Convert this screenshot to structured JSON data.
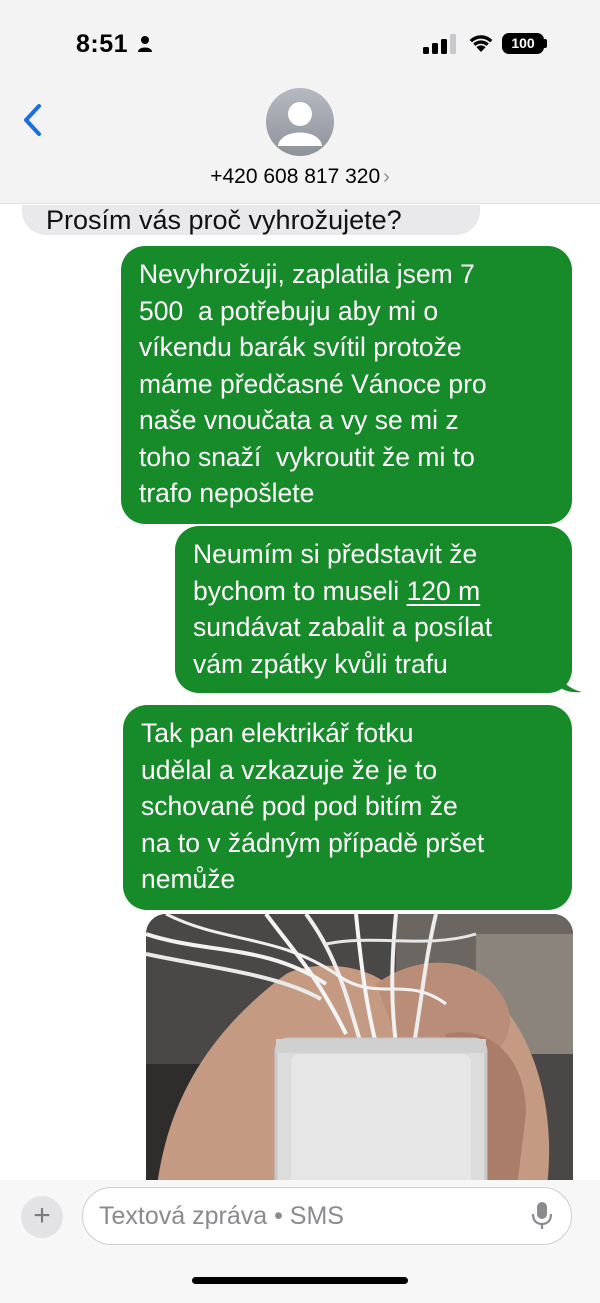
{
  "status_bar": {
    "time": "8:51",
    "battery": "100",
    "icons": [
      "person-icon",
      "cellular-signal-icon",
      "wifi-icon",
      "battery-icon"
    ]
  },
  "header": {
    "back_icon": "chevron-left-icon",
    "avatar_icon": "contact-avatar-icon",
    "contact": "+420 608 817 320",
    "chevron": "›"
  },
  "messages": [
    {
      "direction": "incoming",
      "text": "Prosím vás proč vyhrožujete?"
    },
    {
      "direction": "outgoing",
      "lines": [
        "Nevyhrožuji, zaplatila jsem 7",
        "500  a potřebuju aby mi o",
        "víkendu barák svítil protože",
        "máme předčasné Vánoce pro",
        "naše vnoučata a vy se mi z",
        "toho snaží  vykroutit že mi to",
        "trafo nepošlete"
      ]
    },
    {
      "direction": "outgoing",
      "line1": "Neumím si představit že",
      "line2_prefix": "bychom to museli ",
      "line2_link": "120 m",
      "line3": "sundávat zabalit a posílat",
      "line4": "vám zpátky kvůli trafu"
    },
    {
      "direction": "outgoing",
      "lines": [
        "Tak pan elektrikář fotku",
        "udělal a vzkazuje že je to",
        "schované pod pod bitím že",
        "na to v žádným případě pršet",
        "nemůže"
      ]
    },
    {
      "direction": "outgoing",
      "type": "photo",
      "subject": "hand holding white transformer box with cables"
    }
  ],
  "input_bar": {
    "plus": "+",
    "placeholder": "Textová zpráva • SMS",
    "mic_icon": "microphone-icon"
  },
  "colors": {
    "sms_green": "#178a29",
    "incoming_gray": "#e9e9eb",
    "ios_blue": "#1a6fe0",
    "bar_background": "#f3f3f4"
  }
}
